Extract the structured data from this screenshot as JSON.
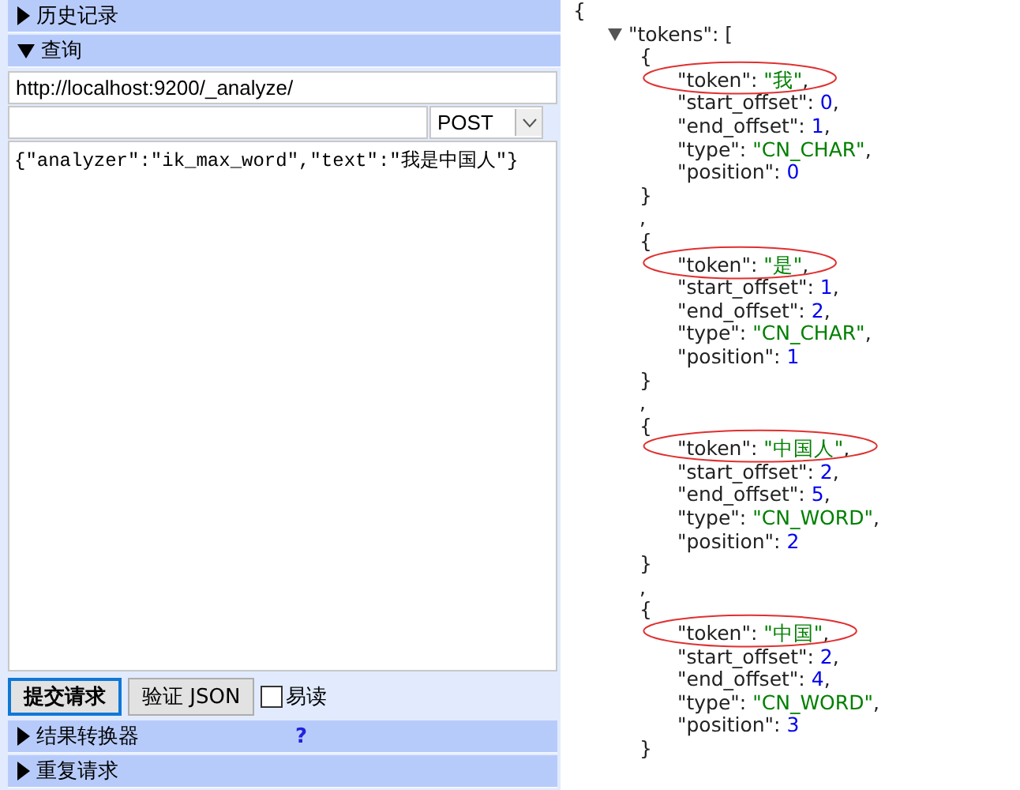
{
  "left_panel": {
    "sections": [
      {
        "label": "历史记录",
        "expanded": false
      },
      {
        "label": "查询",
        "expanded": true
      }
    ],
    "url": {
      "value": "http://localhost:9200/_analyze/"
    },
    "method": {
      "value": "POST"
    },
    "body": {
      "value": "{\"analyzer\":\"ik_max_word\",\"text\":\"我是中国人\"}"
    },
    "buttons": [
      {
        "label": "提交请求",
        "focused": true
      },
      {
        "label": "验证 JSON",
        "focused": false
      }
    ],
    "pretty": {
      "label": "易读",
      "checked": false
    },
    "footer_sections": [
      {
        "label": "结果转换器",
        "expanded": false,
        "help": "?"
      },
      {
        "label": "重复请求",
        "expanded": false
      }
    ]
  },
  "json_view": {
    "open": "{",
    "tokens_key": "\"tokens\": [",
    "expanded": true,
    "objects": [
      {
        "open": "{",
        "close": "}",
        "circled": true,
        "fields": [
          {
            "key": "\"token\": ",
            "value": "\"我\"",
            "kind": "string",
            "end": ","
          },
          {
            "key": "\"start_offset\": ",
            "value": "0",
            "kind": "number",
            "end": ","
          },
          {
            "key": "\"end_offset\": ",
            "value": "1",
            "kind": "number",
            "end": ","
          },
          {
            "key": "\"type\": ",
            "value": "\"CN_CHAR\"",
            "kind": "string",
            "end": ","
          },
          {
            "key": "\"position\": ",
            "value": "0",
            "kind": "number"
          }
        ]
      },
      {
        "sep": ",",
        "open": "{",
        "close": "}",
        "circled": true,
        "fields": [
          {
            "key": "\"token\": ",
            "value": "\"是\"",
            "kind": "string",
            "end": ","
          },
          {
            "key": "\"start_offset\": ",
            "value": "1",
            "kind": "number",
            "end": ","
          },
          {
            "key": "\"end_offset\": ",
            "value": "2",
            "kind": "number",
            "end": ","
          },
          {
            "key": "\"type\": ",
            "value": "\"CN_CHAR\"",
            "kind": "string",
            "end": ","
          },
          {
            "key": "\"position\": ",
            "value": "1",
            "kind": "number"
          }
        ]
      },
      {
        "sep": ",",
        "open": "{",
        "close": "}",
        "circled": true,
        "fields": [
          {
            "key": "\"token\": ",
            "value": "\"中国人\"",
            "kind": "string",
            "end": ","
          },
          {
            "key": "\"start_offset\": ",
            "value": "2",
            "kind": "number",
            "end": ","
          },
          {
            "key": "\"end_offset\": ",
            "value": "5",
            "kind": "number",
            "end": ","
          },
          {
            "key": "\"type\": ",
            "value": "\"CN_WORD\"",
            "kind": "string",
            "end": ","
          },
          {
            "key": "\"position\": ",
            "value": "2",
            "kind": "number"
          }
        ]
      },
      {
        "sep": ",",
        "open": "{",
        "close": "}",
        "circled": true,
        "fields": [
          {
            "key": "\"token\": ",
            "value": "\"中国\"",
            "kind": "string",
            "end": ","
          },
          {
            "key": "\"start_offset\": ",
            "value": "2",
            "kind": "number",
            "end": ","
          },
          {
            "key": "\"end_offset\": ",
            "value": "4",
            "kind": "number",
            "end": ","
          },
          {
            "key": "\"type\": ",
            "value": "\"CN_WORD\"",
            "kind": "string",
            "end": ","
          },
          {
            "key": "\"position\": ",
            "value": "3",
            "kind": "number"
          }
        ]
      }
    ]
  }
}
